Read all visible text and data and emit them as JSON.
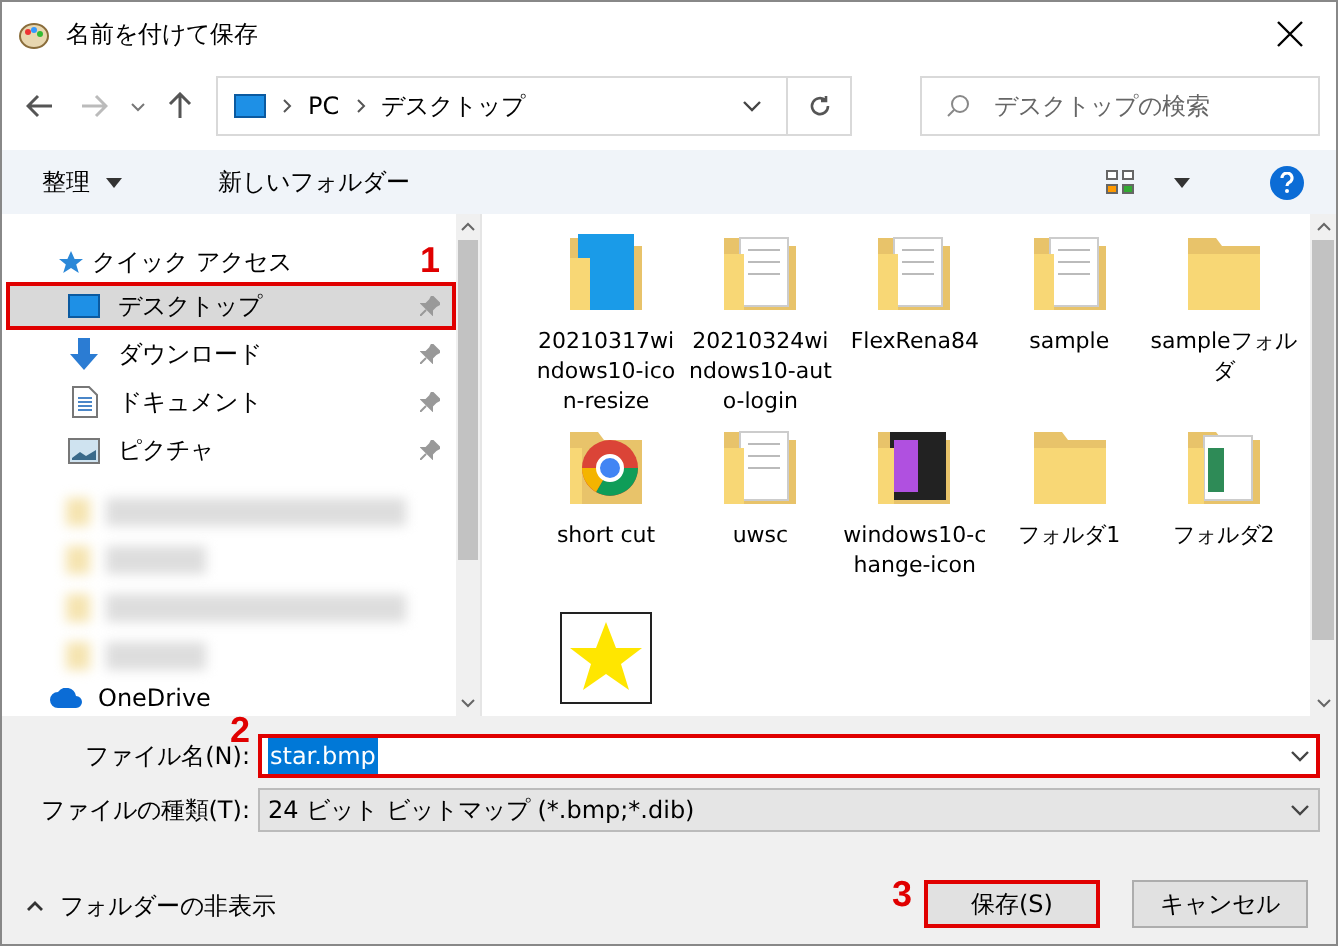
{
  "window": {
    "title": "名前を付けて保存"
  },
  "address": {
    "path": [
      "PC",
      "デスクトップ"
    ]
  },
  "search": {
    "placeholder": "デスクトップの検索"
  },
  "toolbar": {
    "organize": "整理",
    "new_folder": "新しいフォルダー"
  },
  "sidebar": {
    "header": "クイック アクセス",
    "items": [
      {
        "label": "デスクトップ",
        "kind": "desktop",
        "selected": true,
        "highlighted": true,
        "badge": "1"
      },
      {
        "label": "ダウンロード",
        "kind": "download",
        "selected": false,
        "highlighted": false
      },
      {
        "label": "ドキュメント",
        "kind": "document",
        "selected": false,
        "highlighted": false
      },
      {
        "label": "ピクチャ",
        "kind": "picture",
        "selected": false,
        "highlighted": false
      }
    ],
    "footer": "OneDrive"
  },
  "files": [
    {
      "name": "20210317windows10-icon-resize",
      "kind": "folder-blue"
    },
    {
      "name": "20210324windows10-auto-login",
      "kind": "folder-docs"
    },
    {
      "name": "FlexRena84",
      "kind": "folder-docs"
    },
    {
      "name": "sample",
      "kind": "folder-docs"
    },
    {
      "name": "sampleフォルダ",
      "kind": "folder"
    },
    {
      "name": "short cut",
      "kind": "folder-round"
    },
    {
      "name": "uwsc",
      "kind": "folder-docs"
    },
    {
      "name": "windows10-change-icon",
      "kind": "folder-dark"
    },
    {
      "name": "フォルダ1",
      "kind": "folder"
    },
    {
      "name": "フォルダ2",
      "kind": "folder-sheet"
    },
    {
      "kind": "image-star"
    }
  ],
  "form": {
    "filename_label": "ファイル名(N):",
    "filename_value": "star.bmp",
    "filename_highlighted": true,
    "filename_badge": "2",
    "type_label": "ファイルの種類(T):",
    "type_value": "24 ビット ビットマップ (*.bmp;*.dib)"
  },
  "footer": {
    "hide_folders": "フォルダーの非表示",
    "save": "保存(S)",
    "save_highlighted": true,
    "save_badge": "3",
    "cancel": "キャンセル"
  }
}
